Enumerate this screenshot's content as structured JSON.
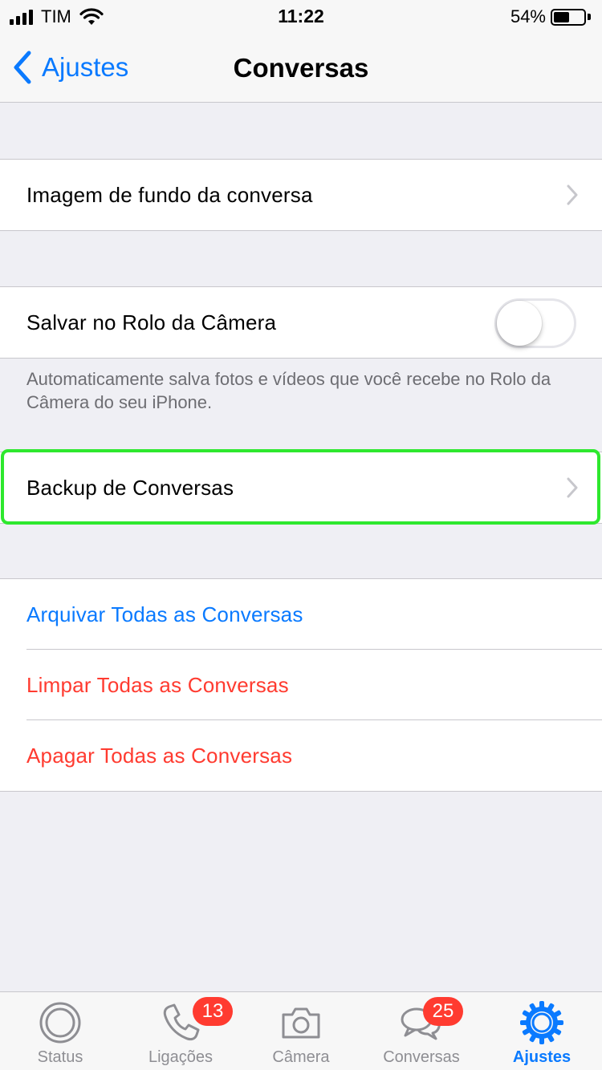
{
  "status_bar": {
    "carrier": "TIM",
    "time": "11:22",
    "battery_percent": "54%",
    "battery_level": 0.54
  },
  "nav": {
    "back_label": "Ajustes",
    "title": "Conversas"
  },
  "cells": {
    "wallpaper": "Imagem de fundo da conversa",
    "save_to_camera_roll": "Salvar no Rolo da Câmera",
    "save_to_camera_roll_on": false,
    "save_footnote": "Automaticamente salva fotos e vídeos que você recebe no Rolo da Câmera do seu iPhone.",
    "chat_backup": "Backup de Conversas"
  },
  "actions": {
    "archive_all": "Arquivar Todas as Conversas",
    "clear_all": "Limpar Todas as Conversas",
    "delete_all": "Apagar Todas as Conversas"
  },
  "colors": {
    "accent_blue": "#0a7aff",
    "destructive_red": "#ff3b30",
    "highlight_green": "#2ee82e"
  },
  "tab_bar": {
    "tabs": [
      {
        "label": "Status",
        "icon": "status-icon",
        "badge": ""
      },
      {
        "label": "Ligações",
        "icon": "phone-icon",
        "badge": "13"
      },
      {
        "label": "Câmera",
        "icon": "camera-icon",
        "badge": ""
      },
      {
        "label": "Conversas",
        "icon": "chat-bubbles-icon",
        "badge": "25"
      },
      {
        "label": "Ajustes",
        "icon": "settings-gear-icon",
        "badge": "",
        "active": true
      }
    ]
  }
}
